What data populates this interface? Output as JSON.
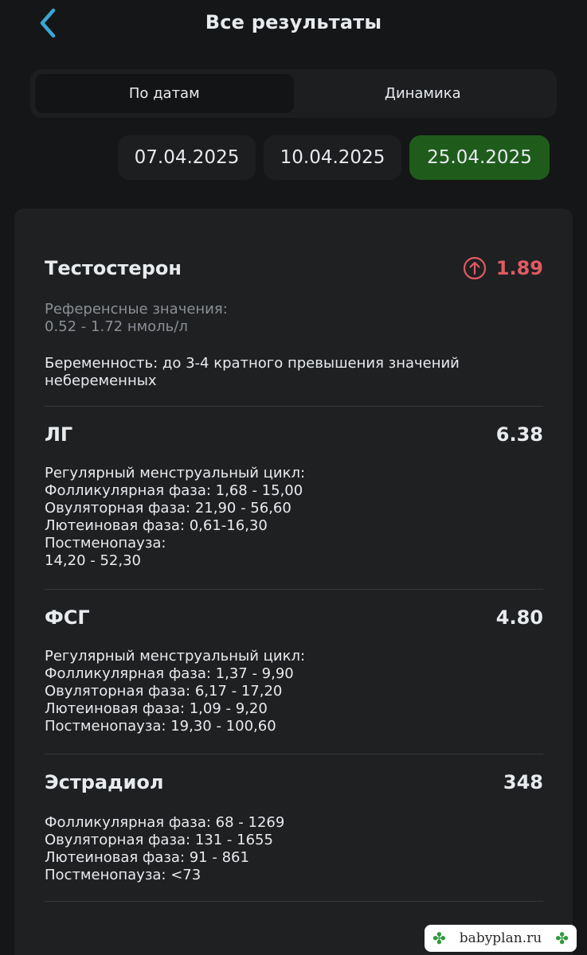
{
  "header": {
    "title": "Все результаты"
  },
  "tabs": [
    {
      "label": "По датам",
      "active": true
    },
    {
      "label": "Динамика",
      "active": false
    }
  ],
  "dates": [
    {
      "label": "07.04.2025",
      "selected": false
    },
    {
      "label": "10.04.2025",
      "selected": false
    },
    {
      "label": "25.04.2025",
      "selected": true
    }
  ],
  "results": [
    {
      "name": "Тестостерон",
      "value": "1.89",
      "status": "high",
      "ref_muted": "Референсные значения:\n0.52 - 1.72 нмоль/л",
      "ref": "Беременность: до 3-4 кратного превышения значений небеременных"
    },
    {
      "name": "ЛГ",
      "value": "6.38",
      "ref": "Регулярный менструальный цикл:\nФолликулярная фаза: 1,68 - 15,00\nОвуляторная фаза: 21,90 - 56,60\nЛютеиновая фаза: 0,61-16,30\nПостменопауза:\n14,20 - 52,30"
    },
    {
      "name": "ФСГ",
      "value": "4.80",
      "ref": "Регулярный менструальный цикл:\nФолликулярная фаза: 1,37 - 9,90\nОвуляторная фаза: 6,17 - 17,20\nЛютеиновая фаза: 1,09 - 9,20\nПостменопауза: 19,30 - 100,60"
    },
    {
      "name": "Эстрадиол",
      "value": "348",
      "ref": "Фолликулярная фаза: 68 - 1269\nОвуляторная фаза: 131 - 1655\nЛютеиновая фаза: 91 - 861\nПостменопауза: <73"
    }
  ],
  "colors": {
    "accent_back": "#3aa7d4",
    "selected_date": "#1f5c1c",
    "alert": "#e05a62"
  },
  "watermark": {
    "text": "babyplan.ru"
  }
}
